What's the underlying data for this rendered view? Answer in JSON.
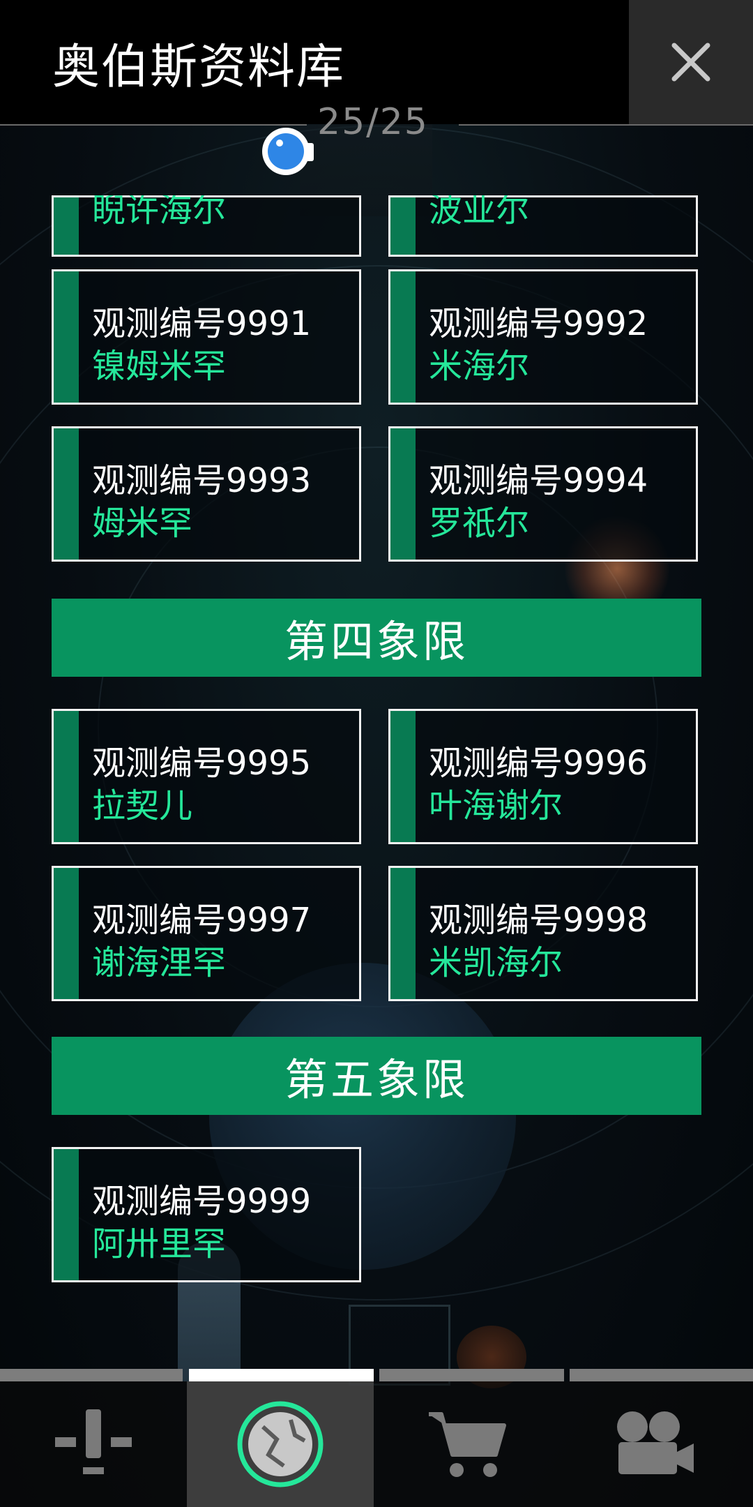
{
  "header": {
    "title": "奥伯斯资料库",
    "page_counter": "25/25"
  },
  "entries_partial": [
    {
      "name": "睨许海尔"
    },
    {
      "name": "波业尔"
    }
  ],
  "entries": [
    {
      "code": "观测编号9991",
      "name": "镍姆米罕"
    },
    {
      "code": "观测编号9992",
      "name": "米海尔"
    },
    {
      "code": "观测编号9993",
      "name": "姆米罕"
    },
    {
      "code": "观测编号9994",
      "name": "罗祇尔"
    },
    {
      "code": "观测编号9995",
      "name": "拉契儿"
    },
    {
      "code": "观测编号9996",
      "name": "叶海谢尔"
    },
    {
      "code": "观测编号9997",
      "name": "谢海浬罕"
    },
    {
      "code": "观测编号9998",
      "name": "米凯海尔"
    },
    {
      "code": "观测编号9999",
      "name": "阿卅里罕"
    }
  ],
  "sections": [
    {
      "label": "第四象限"
    },
    {
      "label": "第五象限"
    }
  ],
  "nav": {
    "items": [
      "tools-icon",
      "planet-icon",
      "cart-icon",
      "video-camera-icon"
    ],
    "active_index": 1
  },
  "colors": {
    "accent_green": "#08945f",
    "name_green": "#25e79a",
    "stripe_green": "#087a52",
    "eye_blue": "#2e86e6"
  }
}
